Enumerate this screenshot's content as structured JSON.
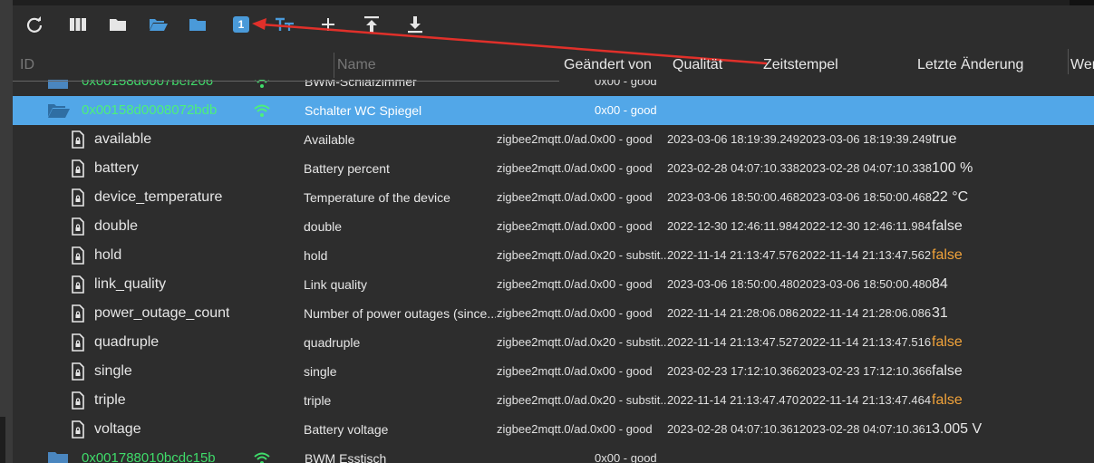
{
  "toolbar": {
    "badge": "1",
    "icons": [
      "refresh-icon",
      "columns-icon",
      "folder-icon",
      "folder-open-icon",
      "folder-blue-icon",
      "number-badge-icon",
      "text-size-icon",
      "plus-icon",
      "upload-icon",
      "download-icon"
    ]
  },
  "header": {
    "id": "ID",
    "name": "Name",
    "changed_by": "Geändert von",
    "quality": "Qualität",
    "timestamp": "Zeitstempel",
    "last_change": "Letzte Änderung",
    "value": "Wer"
  },
  "devices": [
    {
      "id": "0x00158d0007bef206",
      "name": "BWM-Schlafzimmer",
      "quality": "0x00 - good"
    },
    {
      "id": "0x00158d0008072bdb",
      "name": "Schalter WC Spiegel",
      "quality": "0x00 - good"
    },
    {
      "id": "0x001788010bcdc15b",
      "name": "BWM Esstisch",
      "quality": "0x00 - good"
    }
  ],
  "states": [
    {
      "id": "available",
      "name": "Available",
      "from": "zigbee2mqtt.0/ad...",
      "quality": "0x00 - good",
      "ts": "2023-03-06 18:19:39.249",
      "lc": "2023-03-06 18:19:39.249",
      "value": "true",
      "warn": false
    },
    {
      "id": "battery",
      "name": "Battery percent",
      "from": "zigbee2mqtt.0/ad...",
      "quality": "0x00 - good",
      "ts": "2023-02-28 04:07:10.338",
      "lc": "2023-02-28 04:07:10.338",
      "value": "100 %",
      "warn": false
    },
    {
      "id": "device_temperature",
      "name": "Temperature of the device",
      "from": "zigbee2mqtt.0/ad...",
      "quality": "0x00 - good",
      "ts": "2023-03-06 18:50:00.468",
      "lc": "2023-03-06 18:50:00.468",
      "value": "22 °C",
      "warn": false
    },
    {
      "id": "double",
      "name": "double",
      "from": "zigbee2mqtt.0/ad...",
      "quality": "0x00 - good",
      "ts": "2022-12-30 12:46:11.984",
      "lc": "2022-12-30 12:46:11.984",
      "value": "false",
      "warn": false
    },
    {
      "id": "hold",
      "name": "hold",
      "from": "zigbee2mqtt.0/ad...",
      "quality": "0x20 - substit...",
      "ts": "2022-11-14 21:13:47.576",
      "lc": "2022-11-14 21:13:47.562",
      "value": "false",
      "warn": true
    },
    {
      "id": "link_quality",
      "name": "Link quality",
      "from": "zigbee2mqtt.0/ad...",
      "quality": "0x00 - good",
      "ts": "2023-03-06 18:50:00.480",
      "lc": "2023-03-06 18:50:00.480",
      "value": "84",
      "warn": false
    },
    {
      "id": "power_outage_count",
      "name": "Number of power outages (since...",
      "from": "zigbee2mqtt.0/ad...",
      "quality": "0x00 - good",
      "ts": "2022-11-14 21:28:06.086",
      "lc": "2022-11-14 21:28:06.086",
      "value": "31",
      "warn": false
    },
    {
      "id": "quadruple",
      "name": "quadruple",
      "from": "zigbee2mqtt.0/ad...",
      "quality": "0x20 - substit...",
      "ts": "2022-11-14 21:13:47.527",
      "lc": "2022-11-14 21:13:47.516",
      "value": "false",
      "warn": true
    },
    {
      "id": "single",
      "name": "single",
      "from": "zigbee2mqtt.0/ad...",
      "quality": "0x00 - good",
      "ts": "2023-02-23 17:12:10.366",
      "lc": "2023-02-23 17:12:10.366",
      "value": "false",
      "warn": false
    },
    {
      "id": "triple",
      "name": "triple",
      "from": "zigbee2mqtt.0/ad...",
      "quality": "0x20 - substit...",
      "ts": "2022-11-14 21:13:47.470",
      "lc": "2022-11-14 21:13:47.464",
      "value": "false",
      "warn": true
    },
    {
      "id": "voltage",
      "name": "Battery voltage",
      "from": "zigbee2mqtt.0/ad...",
      "quality": "0x00 - good",
      "ts": "2023-02-28 04:07:10.361",
      "lc": "2023-02-28 04:07:10.361",
      "value": "3.005 V",
      "warn": false
    }
  ],
  "colors": {
    "selected": "#52a7e8",
    "device_id": "#3fdc6a",
    "warn_value": "#f0a23a",
    "annotation": "#e0302a",
    "folder": "#4a9ad9"
  }
}
